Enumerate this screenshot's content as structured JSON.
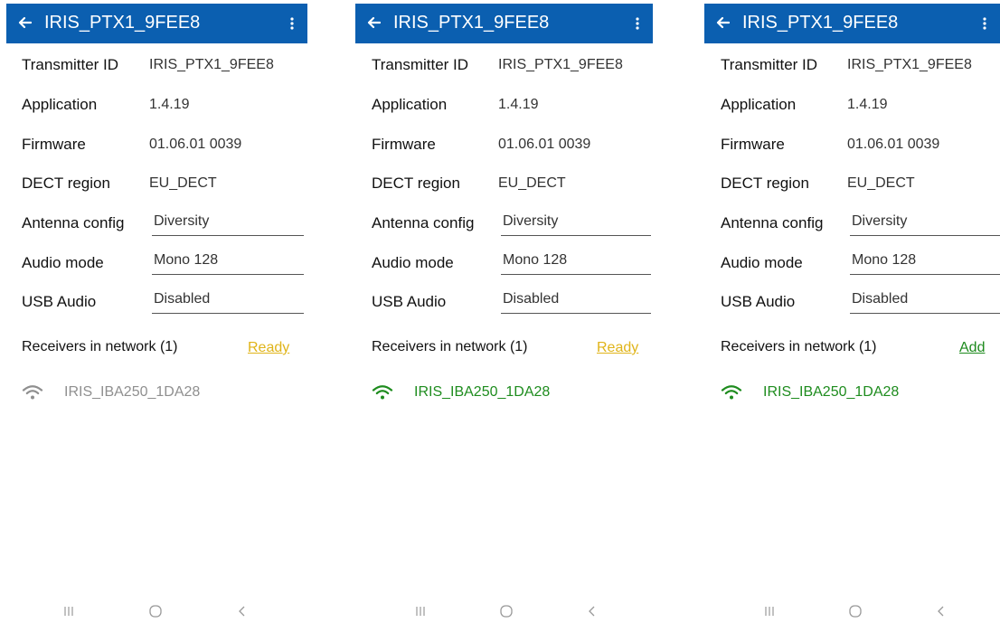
{
  "colors": {
    "appbar": "#0b5fb0",
    "ready": "#e0b419",
    "add": "#1d8a1d",
    "connected": "#1e8c1e",
    "disconnected": "#8f8f8f"
  },
  "labels": {
    "transmitter_id": "Transmitter ID",
    "application": "Application",
    "firmware": "Firmware",
    "dect_region": "DECT region",
    "antenna_config": "Antenna config",
    "audio_mode": "Audio mode",
    "usb_audio": "USB Audio",
    "receivers": "Receivers in network (1)"
  },
  "screens": [
    {
      "title": "IRIS_PTX1_9FEE8",
      "transmitter_id": "IRIS_PTX1_9FEE8",
      "application": "1.4.19",
      "firmware": "01.06.01 0039",
      "dect_region": "EU_DECT",
      "antenna_config": "Diversity",
      "audio_mode": "Mono 128",
      "usb_audio": "Disabled",
      "action": "Ready",
      "receiver": {
        "name": "IRIS_IBA250_1DA28",
        "icon": "wifi-icon",
        "state": "disconnected"
      }
    },
    {
      "title": "IRIS_PTX1_9FEE8",
      "transmitter_id": "IRIS_PTX1_9FEE8",
      "application": "1.4.19",
      "firmware": "01.06.01 0039",
      "dect_region": "EU_DECT",
      "antenna_config": "Diversity",
      "audio_mode": "Mono 128",
      "usb_audio": "Disabled",
      "action": "Ready",
      "receiver": {
        "name": "IRIS_IBA250_1DA28",
        "icon": "wifi-icon",
        "state": "connected"
      }
    },
    {
      "title": "IRIS_PTX1_9FEE8",
      "transmitter_id": "IRIS_PTX1_9FEE8",
      "application": "1.4.19",
      "firmware": "01.06.01 0039",
      "dect_region": "EU_DECT",
      "antenna_config": "Diversity",
      "audio_mode": "Mono 128",
      "usb_audio": "Disabled",
      "action": "Add",
      "receiver": {
        "name": "IRIS_IBA250_1DA28",
        "icon": "wifi-icon",
        "state": "connected"
      }
    }
  ]
}
